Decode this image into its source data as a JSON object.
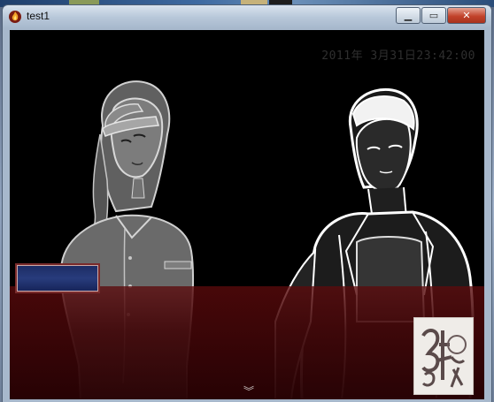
{
  "window": {
    "title": "test1",
    "controls": {
      "minimize": "▁",
      "maximize": "▭",
      "close": "✕"
    }
  },
  "hud": {
    "datetime": "2011年 3月31日23:42:00"
  },
  "dialogue": {
    "speaker_name": "",
    "continue_indicator": "︾"
  },
  "colors": {
    "message_window": "#5c0a0c",
    "name_box": "#283c7c",
    "name_box_border": "#7a2b2b",
    "close_button": "#c2432b"
  },
  "icons": {
    "app": "flame-icon",
    "continue": "double-chevron-down-icon",
    "logo": "game-logo"
  }
}
